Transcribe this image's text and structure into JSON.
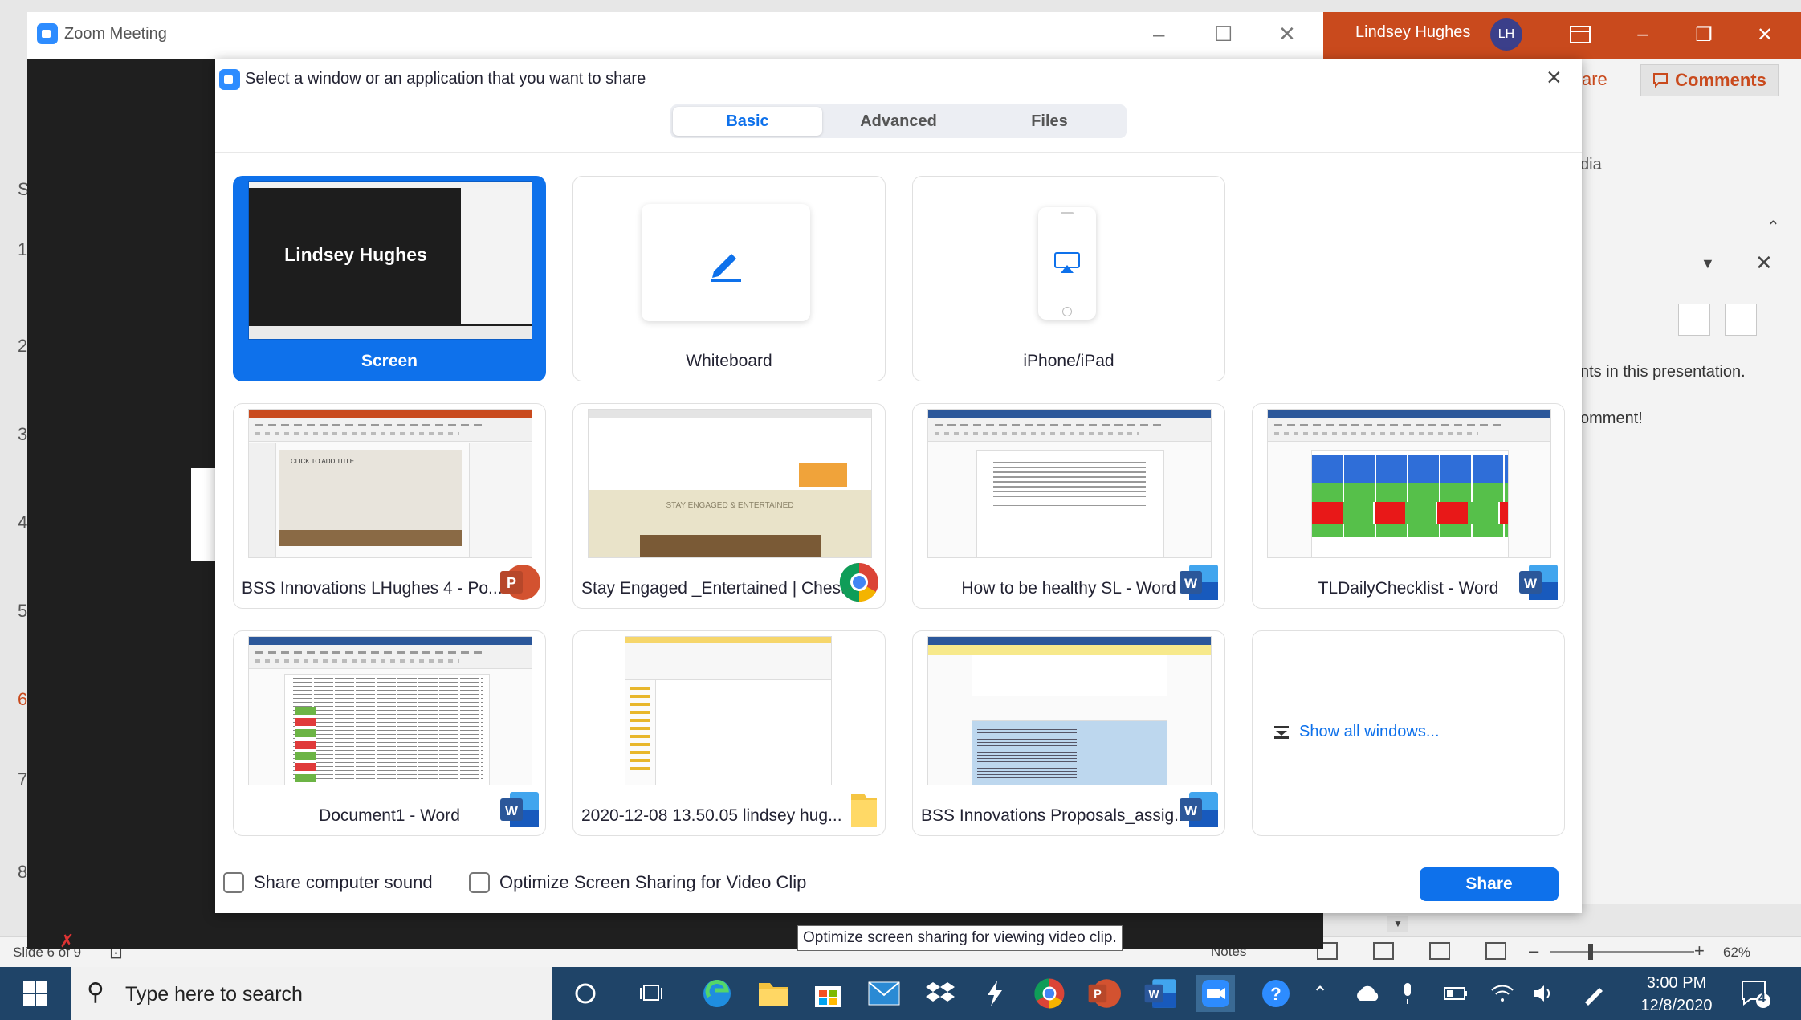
{
  "powerpoint": {
    "user_name": "Lindsey Hughes",
    "user_initials": "LH",
    "share_partial": "are",
    "comments_label": "Comments",
    "media_partial": "dia",
    "pane_text_1": "nts in this presentation.",
    "pane_text_2": "omment!",
    "thumb_numbers": [
      "1",
      "2",
      "3",
      "4",
      "5",
      "6",
      "7",
      "8"
    ],
    "left_partial": "S",
    "slide_count": "Slide 6 of 9",
    "notes_label": "Notes",
    "zoom_level": "62%"
  },
  "zoom_window": {
    "title": "Zoom Meeting"
  },
  "dialog": {
    "title": "Select a window or an application that you want to share",
    "tabs": [
      {
        "label": "Basic",
        "active": true
      },
      {
        "label": "Advanced",
        "active": false
      },
      {
        "label": "Files",
        "active": false
      }
    ],
    "basic_options": [
      {
        "label": "Screen",
        "selected": true,
        "thumb_text": "Lindsey Hughes"
      },
      {
        "label": "Whiteboard",
        "selected": false
      },
      {
        "label": "iPhone/iPad",
        "selected": false
      }
    ],
    "windows": [
      {
        "label": "BSS Innovations LHughes 4 - Po...",
        "app": "powerpoint",
        "thumb_text": "CLICK TO ADD TITLE"
      },
      {
        "label": "Stay Engaged _Entertained | Chest...",
        "app": "chrome",
        "thumb_text": "STAY ENGAGED & ENTERTAINED"
      },
      {
        "label": "How to be healthy SL - Word",
        "app": "word"
      },
      {
        "label": "TLDailyChecklist - Word",
        "app": "word"
      },
      {
        "label": "Document1 - Word",
        "app": "word"
      },
      {
        "label": "2020-12-08 13.50.05 lindsey hug...",
        "app": "folder"
      },
      {
        "label": "BSS Innovations Proposals_assig...",
        "app": "word"
      }
    ],
    "show_all_label": "Show all windows...",
    "share_sound_label": "Share computer sound",
    "optimize_label": "Optimize Screen Sharing for Video Clip",
    "share_button": "Share",
    "tooltip": "Optimize screen sharing for viewing video clip.",
    "colors": {
      "accent": "#0e71eb",
      "zoom_blue": "#2d8cff"
    }
  },
  "taskbar": {
    "search_placeholder": "Type here to search",
    "time": "3:00 PM",
    "date": "12/8/2020",
    "notification_count": "4"
  }
}
